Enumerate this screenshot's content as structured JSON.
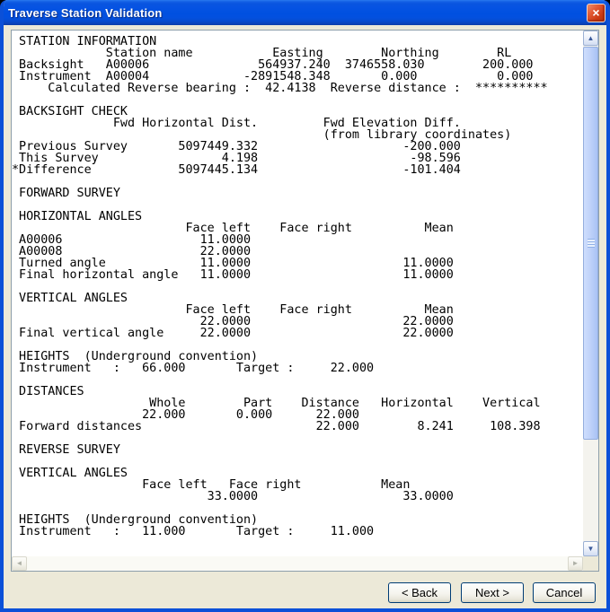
{
  "window": {
    "title": "Traverse Station Validation"
  },
  "icons": {
    "close": "×",
    "scroll_up": "▲",
    "scroll_down": "▼",
    "scroll_left": "◄",
    "scroll_right": "►"
  },
  "colors": {
    "titlebar_blue": "#0050E0",
    "window_border_blue": "#0B50D8",
    "dialog_background": "#ECE9D8",
    "panel_background": "#FFFFFF",
    "panel_border": "#8E9FAB",
    "close_button_red": "#CC3B14",
    "scroll_thumb_blue": "#B9CDF8",
    "button_border_blue": "#003C74",
    "text": "#000000"
  },
  "report": {
    "lines": [
      " STATION INFORMATION",
      "             Station name           Easting        Northing        RL",
      " Backsight   A00006               564937.240  3746558.030        200.000",
      " Instrument  A00004             -2891548.348       0.000           0.000",
      "     Calculated Reverse bearing :  42.4138  Reverse distance :  **********",
      "",
      " BACKSIGHT CHECK",
      "              Fwd Horizontal Dist.         Fwd Elevation Diff.",
      "                                           (from library coordinates)",
      " Previous Survey       5097449.332                    -200.000",
      " This Survey                 4.198                     -98.596",
      "*Difference            5097445.134                    -101.404",
      "",
      " FORWARD SURVEY",
      "",
      " HORIZONTAL ANGLES",
      "                        Face left    Face right          Mean",
      " A00006                   11.0000",
      " A00008                   22.0000",
      " Turned angle             11.0000                     11.0000",
      " Final horizontal angle   11.0000                     11.0000",
      "",
      " VERTICAL ANGLES",
      "                        Face left    Face right          Mean",
      "                          22.0000                     22.0000",
      " Final vertical angle     22.0000                     22.0000",
      "",
      " HEIGHTS  (Underground convention)",
      " Instrument   :   66.000       Target :     22.000",
      "",
      " DISTANCES",
      "                   Whole        Part    Distance   Horizontal    Vertical",
      "                  22.000       0.000      22.000",
      " Forward distances                        22.000        8.241     108.398",
      "",
      " REVERSE SURVEY",
      "",
      " VERTICAL ANGLES",
      "                  Face left   Face right           Mean",
      "                           33.0000                    33.0000",
      "",
      " HEIGHTS  (Underground convention)",
      " Instrument   :   11.000       Target :     11.000"
    ]
  },
  "buttons": {
    "back": "< Back",
    "next": "Next >",
    "cancel": "Cancel"
  }
}
